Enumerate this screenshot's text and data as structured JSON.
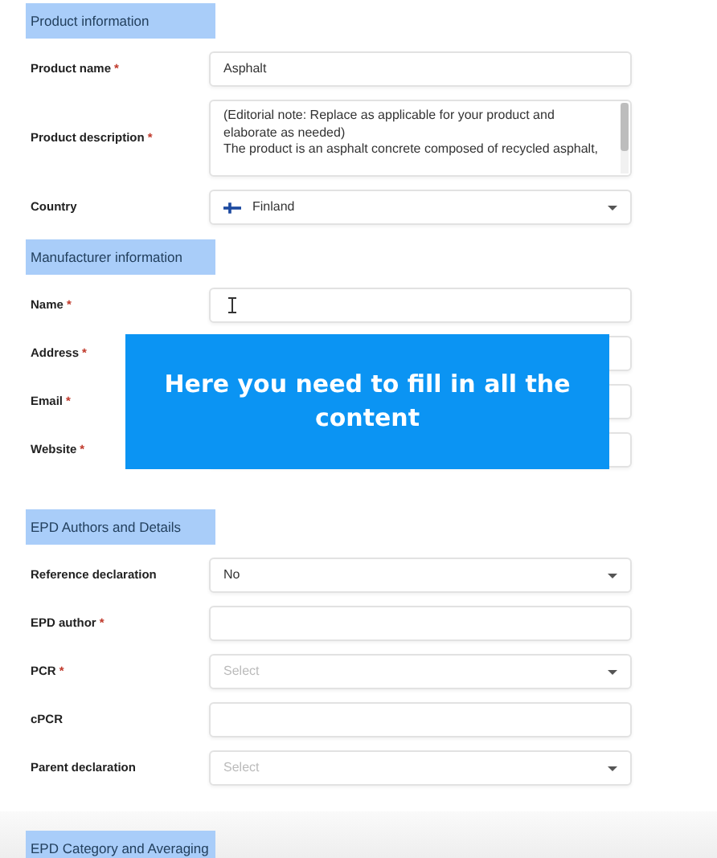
{
  "sections": [
    {
      "title": "Product information",
      "fields": [
        {
          "label": "Product name",
          "required_mark": "*",
          "kind": "text",
          "value": "Asphalt"
        },
        {
          "label": "Product description",
          "required_mark": "*",
          "kind": "textarea",
          "value": "(Editorial note: Replace as applicable for your product and elaborate as needed)\nThe product is an asphalt concrete composed of recycled asphalt,"
        },
        {
          "label": "Country",
          "kind": "country",
          "value": "Finland"
        }
      ]
    },
    {
      "title": "Manufacturer information",
      "fields": [
        {
          "label": "Name",
          "required_mark": "*",
          "kind": "text",
          "focused": true
        },
        {
          "label": "Address",
          "required_mark": "*",
          "kind": "text"
        },
        {
          "label": "Email",
          "required_mark": "*",
          "kind": "text"
        },
        {
          "label": "Website",
          "required_mark": "*",
          "kind": "text"
        }
      ]
    },
    {
      "title": "EPD Authors and Details",
      "fields": [
        {
          "label": "Reference declaration",
          "kind": "select",
          "value": "No"
        },
        {
          "label": "EPD author",
          "required_mark": "*",
          "kind": "text"
        },
        {
          "label": "PCR",
          "required_mark": "*",
          "kind": "select",
          "placeholder": "Select"
        },
        {
          "label": "cPCR",
          "kind": "text"
        },
        {
          "label": "Parent declaration",
          "kind": "select",
          "placeholder": "Select"
        }
      ]
    },
    {
      "title": "EPD Category and Averaging"
    }
  ],
  "overlay": {
    "text": "Here you need to fill in all the content"
  }
}
